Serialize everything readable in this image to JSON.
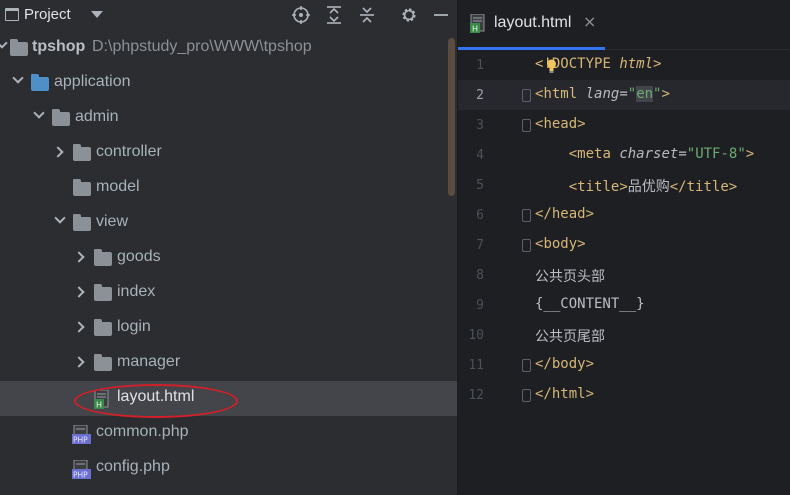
{
  "project_panel": {
    "title": "Project",
    "header_buttons": [
      "locate-icon",
      "expand-all-icon",
      "collapse-all-icon",
      "gear-icon",
      "minimize-icon"
    ],
    "tree": [
      {
        "label": "tpshop",
        "path": "D:\\phpstudy_pro\\WWW\\tpshop",
        "icon": "folder-icon",
        "expanded": true
      },
      {
        "label": "application",
        "icon": "folder-icon",
        "expanded": true
      },
      {
        "label": "admin",
        "icon": "folder-icon",
        "expanded": true
      },
      {
        "label": "controller",
        "icon": "folder-icon",
        "expanded": false
      },
      {
        "label": "model",
        "icon": "folder-icon"
      },
      {
        "label": "view",
        "icon": "folder-icon",
        "expanded": true
      },
      {
        "label": "goods",
        "icon": "folder-icon",
        "expanded": false
      },
      {
        "label": "index",
        "icon": "folder-icon",
        "expanded": false
      },
      {
        "label": "login",
        "icon": "folder-icon",
        "expanded": false
      },
      {
        "label": "manager",
        "icon": "folder-icon",
        "expanded": false
      },
      {
        "label": "layout.html",
        "icon": "html-file-icon",
        "selected": true
      },
      {
        "label": "common.php",
        "icon": "php-file-icon"
      },
      {
        "label": "config.php",
        "icon": "php-file-icon"
      }
    ]
  },
  "editor": {
    "tab": {
      "label": "layout.html",
      "close": "×"
    },
    "lines": [
      {
        "n": "1",
        "parts": {
          "open": "<",
          "doctype": "!DOCTYPE",
          "space": " ",
          "html": "html",
          "close": ">"
        }
      },
      {
        "n": "2",
        "parts": {
          "open": "<",
          "tag": "html",
          "space": " ",
          "attr": "lang",
          "eq": "=",
          "q1": "\"",
          "val": "en",
          "q2": "\"",
          "close": ">"
        }
      },
      {
        "n": "3",
        "parts": {
          "open": "<",
          "tag": "head",
          "close": ">"
        }
      },
      {
        "n": "4",
        "parts": {
          "indent": "    ",
          "open": "<",
          "tag": "meta",
          "space": " ",
          "attr": "charset",
          "eq": "=",
          "val": "\"UTF-8\"",
          "close": ">"
        }
      },
      {
        "n": "5",
        "parts": {
          "indent": "    ",
          "open": "<",
          "tag": "title",
          "close": ">",
          "text": "品优购",
          "open2": "</",
          "tag2": "title",
          "close2": ">"
        }
      },
      {
        "n": "6",
        "parts": {
          "open": "</",
          "tag": "head",
          "close": ">"
        }
      },
      {
        "n": "7",
        "parts": {
          "open": "<",
          "tag": "body",
          "close": ">"
        }
      },
      {
        "n": "8",
        "parts": {
          "text": "公共页头部"
        }
      },
      {
        "n": "9",
        "parts": {
          "text": "{__CONTENT__}"
        }
      },
      {
        "n": "10",
        "parts": {
          "text": "公共页尾部"
        }
      },
      {
        "n": "11",
        "parts": {
          "open": "</",
          "tag": "body",
          "close": ">"
        }
      },
      {
        "n": "12",
        "parts": {
          "open": "</",
          "tag": "html",
          "close": ">"
        }
      }
    ],
    "current_line": "2"
  },
  "colors": {
    "panel_bg": "#2b2d30",
    "editor_bg": "#1e1f22",
    "tag": "#d5b778",
    "string": "#6aab73",
    "accent": "#3574f0",
    "annotation_ellipse": "#d21f2a"
  }
}
